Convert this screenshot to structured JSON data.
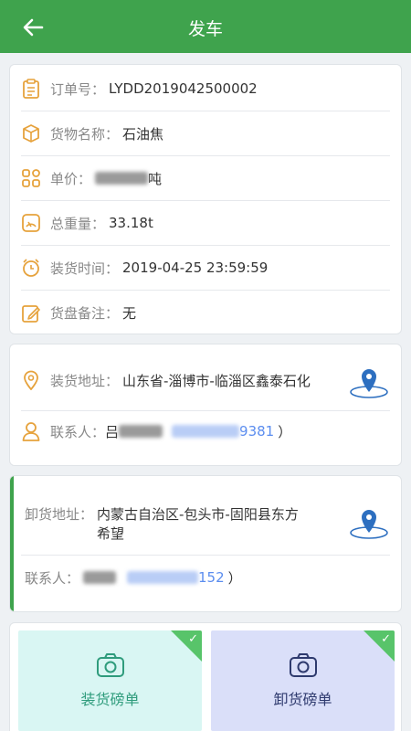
{
  "header": {
    "title": "发车",
    "back_icon": "arrow-left-icon"
  },
  "order": {
    "order_no_label": "订单号：",
    "order_no": "LYDD2019042500002",
    "goods_label": "货物名称：",
    "goods": "石油焦",
    "price_label": "单价：",
    "price_tail": "吨",
    "weight_label": "总重量：",
    "weight": "33.18t",
    "load_time_label": "装货时间：",
    "load_time": "2019-04-25 23:59:59",
    "remark_label": "货盘备注：",
    "remark": "无"
  },
  "loading": {
    "address_label": "装货地址：",
    "address": "山东省-淄博市-临淄区鑫泰石化",
    "contact_label": "联系人：",
    "contact_prefix": "吕",
    "contact_phone_tail": "9381",
    "contact_close": "）"
  },
  "unloading": {
    "address_label": "卸货地址：",
    "address_line1": "内蒙古自治区-包头市-固阳县东方",
    "address_line2": "希望",
    "contact_label": "联系人：",
    "contact_phone_tail": "152",
    "contact_close": "）"
  },
  "uploads": {
    "load_label": "装货磅单",
    "unload_label": "卸货磅单"
  },
  "colors": {
    "brand_green": "#3fa34d",
    "icon_orange": "#e6a23c",
    "link_blue": "#5b8def"
  }
}
